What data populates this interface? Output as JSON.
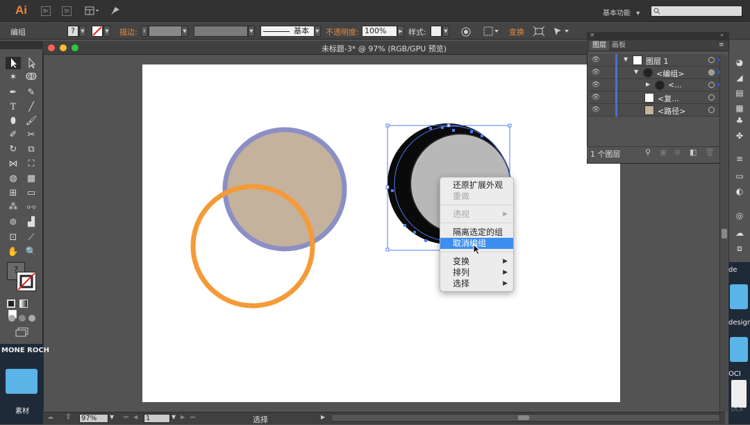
{
  "app": {
    "logo": "Ai",
    "bridge": "Br",
    "stock": "St",
    "workspace": "基本功能",
    "workspace_arrow": "▾"
  },
  "control_bar": {
    "selection_label": "编组",
    "stroke_label": "描边:",
    "stroke_profile": "基本",
    "opacity_label": "不透明度:",
    "opacity_value": "100%",
    "style_label": "样式:",
    "transform_label": "变换"
  },
  "document": {
    "title": "未标题-3* @ 97% (RGB/GPU 预览)"
  },
  "status_bar": {
    "zoom": "97%",
    "artboard_number": "1",
    "tool_name": "选择"
  },
  "layers_panel": {
    "tabs": [
      "图层",
      "画板"
    ],
    "rows": [
      {
        "name": "图层 1",
        "twirl": "▼"
      },
      {
        "name": "<编组>",
        "twirl": "▼"
      },
      {
        "name": "<...",
        "twirl": "▶"
      },
      {
        "name": "<复...",
        "twirl": ""
      },
      {
        "name": "<路径>",
        "twirl": ""
      }
    ],
    "footer_label": "1 个图层"
  },
  "context_menu": {
    "items": [
      {
        "label": "还原扩展外观",
        "disabled": false,
        "submenu": false
      },
      {
        "label": "重做",
        "disabled": true,
        "submenu": false
      },
      {
        "label": "透视",
        "disabled": true,
        "submenu": true
      },
      {
        "label": "隔离选定的组",
        "disabled": false,
        "submenu": false
      },
      {
        "label": "取消编组",
        "disabled": false,
        "submenu": false,
        "highlighted": true
      },
      {
        "label": "变换",
        "disabled": false,
        "submenu": true
      },
      {
        "label": "排列",
        "disabled": false,
        "submenu": true
      },
      {
        "label": "选择",
        "disabled": false,
        "submenu": true
      }
    ],
    "submenu_arrow": "▶"
  },
  "desktop": {
    "left_label_top": "MONE ROCH",
    "left_folder_label": "素材",
    "right_label_1": "de",
    "right_label_2": "design",
    "right_label_3": "OCI",
    "right_label_4": "DCX"
  },
  "colors": {
    "accent_orange": "#e9883a",
    "selection_blue": "#4f7cf5",
    "menu_highlight": "#3c8ef0",
    "circle_fill_tan": "#c4b29c",
    "circle_stroke_purple": "#8b8fc4",
    "circle_stroke_orange": "#f59a38",
    "circle_fill_gray": "#b8b8b8"
  }
}
